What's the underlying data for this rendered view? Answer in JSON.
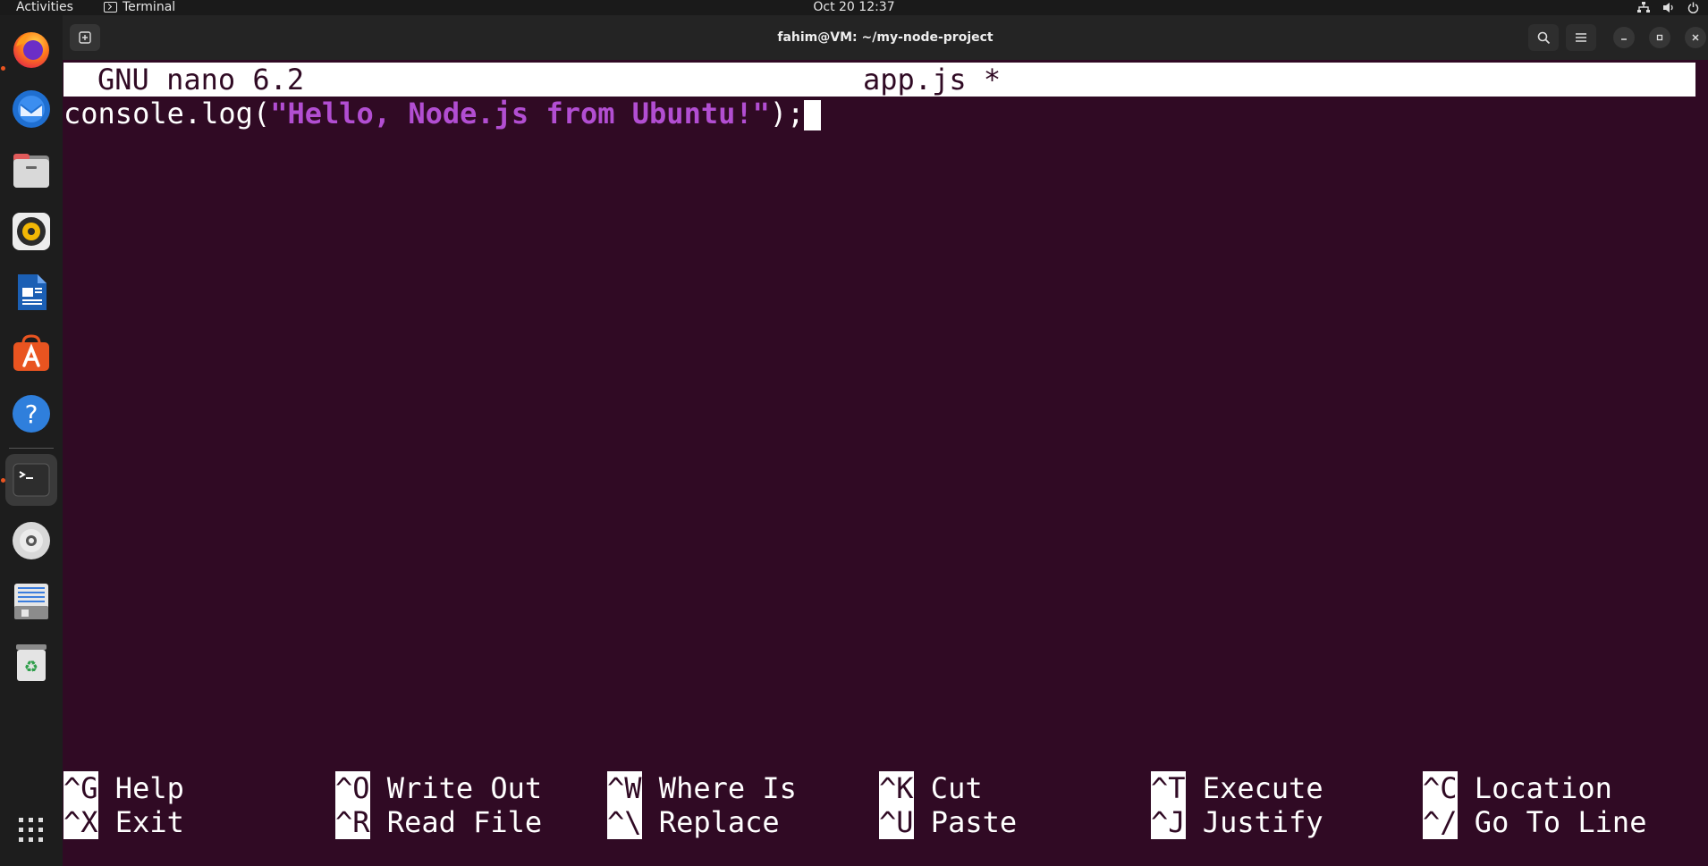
{
  "topbar": {
    "activities": "Activities",
    "app_name": "Terminal",
    "clock": "Oct 20  12:37",
    "tray_icons": [
      "network-icon",
      "volume-icon",
      "power-icon"
    ]
  },
  "dock": {
    "items": [
      {
        "name": "firefox-icon",
        "running": true
      },
      {
        "name": "thunderbird-icon",
        "running": false
      },
      {
        "name": "files-icon",
        "running": false
      },
      {
        "name": "rhythmbox-icon",
        "running": false
      },
      {
        "name": "libreoffice-writer-icon",
        "running": false
      },
      {
        "name": "app-center-icon",
        "running": false
      },
      {
        "name": "help-icon",
        "running": false
      },
      {
        "name": "terminal-icon",
        "running": true,
        "active": true
      },
      {
        "name": "disc-icon",
        "running": false
      },
      {
        "name": "save-document-icon",
        "running": false
      },
      {
        "name": "trash-icon",
        "running": false
      },
      {
        "name": "show-apps-icon",
        "running": false
      }
    ]
  },
  "window": {
    "title": "fahim@VM: ~/my-node-project"
  },
  "nano": {
    "version": "GNU nano 6.2",
    "filename": "app.js *",
    "code": {
      "before": "console.log(",
      "string": "\"Hello, Node.js from Ubuntu!\"",
      "after": ");"
    },
    "shortcuts_row1": [
      {
        "key": "^G",
        "label": "Help"
      },
      {
        "key": "^O",
        "label": "Write Out"
      },
      {
        "key": "^W",
        "label": "Where Is"
      },
      {
        "key": "^K",
        "label": "Cut"
      },
      {
        "key": "^T",
        "label": "Execute"
      },
      {
        "key": "^C",
        "label": "Location"
      }
    ],
    "shortcuts_row2": [
      {
        "key": "^X",
        "label": "Exit"
      },
      {
        "key": "^R",
        "label": "Read File"
      },
      {
        "key": "^\\",
        "label": "Replace"
      },
      {
        "key": "^U",
        "label": "Paste"
      },
      {
        "key": "^J",
        "label": "Justify"
      },
      {
        "key": "^/",
        "label": "Go To Line"
      }
    ]
  },
  "colors": {
    "terminal_bg": "#300a24",
    "string_color": "#b24ed2",
    "accent": "#e95420"
  }
}
